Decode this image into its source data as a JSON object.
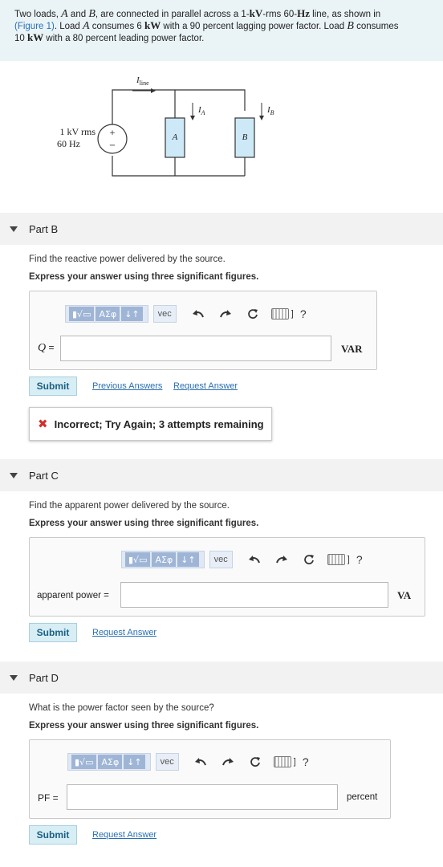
{
  "problem": {
    "line1_pre": "Two loads, ",
    "load_a": "A",
    "and_text": " and ",
    "load_b": "B",
    "line1_mid": ", are connected in parallel across a 1-",
    "kv": "kV",
    "line1_post": "-rms 60-",
    "hz": "Hz",
    "line1_end": " line, as shown in",
    "figure_link": "(Figure 1)",
    "line2_pre": ". Load ",
    "line2_mid": " consumes 6 ",
    "kw": "kW",
    "line2_post": " with a 90 percent lagging power factor. Load ",
    "line2_end": " consumes",
    "line3_pre": "10 ",
    "line3_post": " with a 80 percent leading power factor."
  },
  "circuit": {
    "source_label_1": "1 kV rms",
    "source_label_2": "60 Hz",
    "plus": "+",
    "minus": "−",
    "i_line": "I",
    "i_line_sub": "line",
    "i_a": "I",
    "i_a_sub": "A",
    "i_b": "I",
    "i_b_sub": "B",
    "load_a": "A",
    "load_b": "B"
  },
  "toolbar": {
    "templates": "▮√▭",
    "symbols": "ΑΣφ",
    "arrows": "↓↑",
    "vec": "vec",
    "help": "?"
  },
  "parts": [
    {
      "title": "Part B",
      "question": "Find the reactive power delivered by the source.",
      "instruction": "Express your answer using three significant figures.",
      "label_var": "Q",
      "label_eq": " =",
      "input_value": "",
      "unit": "VAR",
      "submit": "Submit",
      "previous_answers": "Previous Answers",
      "request_answer": "Request Answer",
      "feedback": "Incorrect; Try Again; 3 attempts remaining"
    },
    {
      "title": "Part C",
      "question": "Find the apparent power delivered by the source.",
      "instruction": "Express your answer using three significant figures.",
      "label": "apparent power =",
      "input_value": "",
      "unit": "VA",
      "submit": "Submit",
      "request_answer": "Request Answer"
    },
    {
      "title": "Part D",
      "question": "What is the power factor seen by the source?",
      "instruction": "Express your answer using three significant figures.",
      "label": "PF =",
      "input_value": "",
      "unit": "percent",
      "submit": "Submit",
      "request_answer": "Request Answer"
    }
  ],
  "colors": {
    "problem_bg": "#eaf4f7",
    "link": "#2a6fb3",
    "submit_bg": "#d8eef5",
    "load_fill": "#cde9f7",
    "error": "#d0312d"
  }
}
